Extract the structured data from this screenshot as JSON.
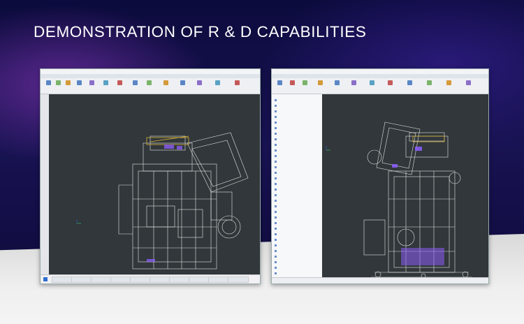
{
  "headline": "DEMONSTRATION OF R & D CAPABILITIES",
  "colors": {
    "background": "#12104a",
    "viewport": "#31373a",
    "wireframe": "#e8e8e8",
    "highlight_yellow": "#d9b23a",
    "highlight_purple": "#8a5cf5"
  },
  "icons": [
    "cad-ribbon-icon",
    "windows-start-icon",
    "folder-tree-icon"
  ]
}
